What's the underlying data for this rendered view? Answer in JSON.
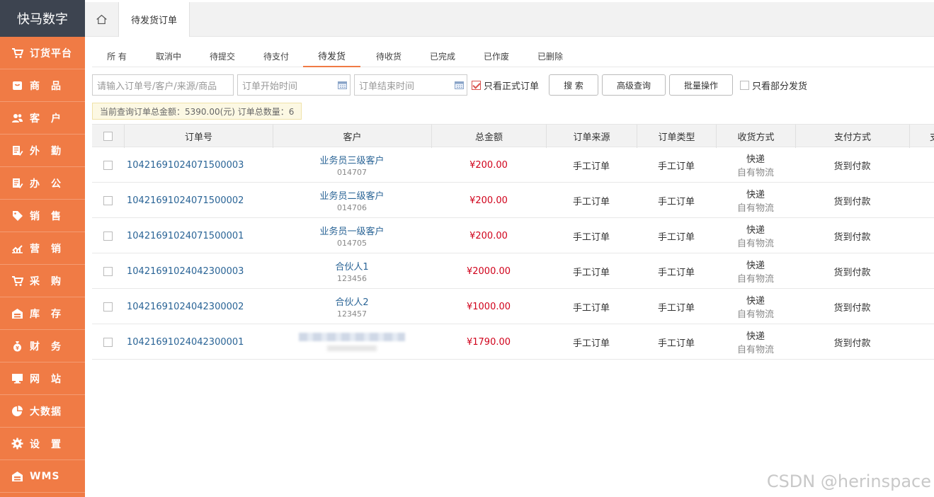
{
  "brand": "快马数字",
  "sidebar": {
    "items": [
      {
        "label": "订货平台",
        "icon": "cart-icon"
      },
      {
        "label": "商　品",
        "icon": "goods-icon"
      },
      {
        "label": "客　户",
        "icon": "customer-icon"
      },
      {
        "label": "外　勤",
        "icon": "fieldwork-icon"
      },
      {
        "label": "办　公",
        "icon": "office-icon"
      },
      {
        "label": "销　售",
        "icon": "tag-icon"
      },
      {
        "label": "营　销",
        "icon": "chart-icon"
      },
      {
        "label": "采　购",
        "icon": "cart-icon"
      },
      {
        "label": "库　存",
        "icon": "warehouse-icon"
      },
      {
        "label": "财　务",
        "icon": "money-bag-icon"
      },
      {
        "label": "网　站",
        "icon": "monitor-icon"
      },
      {
        "label": "大数据",
        "icon": "pie-chart-icon"
      },
      {
        "label": "设　置",
        "icon": "gear-icon"
      },
      {
        "label": "WMS",
        "icon": "wms-icon"
      }
    ]
  },
  "topbar": {
    "page_tab": "待发货订单"
  },
  "status_tabs": [
    "所 有",
    "取消中",
    "待提交",
    "待支付",
    "待发货",
    "待收货",
    "已完成",
    "已作废",
    "已删除"
  ],
  "active_status_tab": "待发货",
  "filters": {
    "search_placeholder": "请输入订单号/客户/来源/商品",
    "start_placeholder": "订单开始时间",
    "end_placeholder": "订单结束时间",
    "formal_only_label": "只看正式订单",
    "formal_only_checked": true,
    "search_button": "搜 索",
    "advanced_button": "高级查询",
    "batch_button": "批量操作",
    "partial_label": "只看部分发货",
    "partial_checked": false
  },
  "summary": "当前查询订单总金额：5390.00(元)   订单总数量：6",
  "table": {
    "headers": [
      "订单号",
      "客户",
      "总金额",
      "订单来源",
      "订单类型",
      "收货方式",
      "支付方式",
      "支"
    ],
    "rows": [
      {
        "order_no": "10421691024071500003",
        "customer": "业务员三级客户",
        "customer_code": "014707",
        "amount": "¥200.00",
        "source": "手工订单",
        "type": "手工订单",
        "delivery": "快递",
        "delivery_sub": "自有物流",
        "payment": "货到付款"
      },
      {
        "order_no": "10421691024071500002",
        "customer": "业务员二级客户",
        "customer_code": "014706",
        "amount": "¥200.00",
        "source": "手工订单",
        "type": "手工订单",
        "delivery": "快递",
        "delivery_sub": "自有物流",
        "payment": "货到付款"
      },
      {
        "order_no": "10421691024071500001",
        "customer": "业务员一级客户",
        "customer_code": "014705",
        "amount": "¥200.00",
        "source": "手工订单",
        "type": "手工订单",
        "delivery": "快递",
        "delivery_sub": "自有物流",
        "payment": "货到付款"
      },
      {
        "order_no": "10421691024042300003",
        "customer": "合伙人1",
        "customer_code": "123456",
        "amount": "¥2000.00",
        "source": "手工订单",
        "type": "手工订单",
        "delivery": "快递",
        "delivery_sub": "自有物流",
        "payment": "货到付款"
      },
      {
        "order_no": "10421691024042300002",
        "customer": "合伙人2",
        "customer_code": "123457",
        "amount": "¥1000.00",
        "source": "手工订单",
        "type": "手工订单",
        "delivery": "快递",
        "delivery_sub": "自有物流",
        "payment": "货到付款"
      },
      {
        "order_no": "10421691024042300001",
        "customer": "",
        "customer_code": "",
        "amount": "¥1790.00",
        "source": "手工订单",
        "type": "手工订单",
        "delivery": "快递",
        "delivery_sub": "自有物流",
        "payment": "货到付款"
      }
    ]
  },
  "watermark": "CSDN @herinspace",
  "colors": {
    "accent": "#f07b45",
    "brand_bg": "#3d4450",
    "price": "#d0021b",
    "link": "#2a6496"
  }
}
